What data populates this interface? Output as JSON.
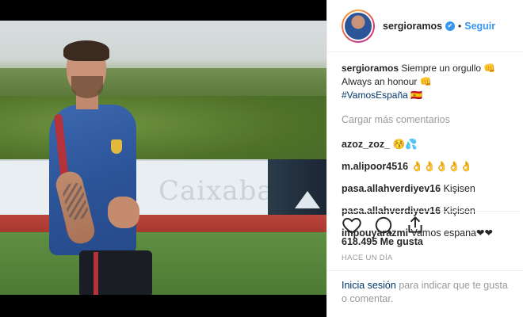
{
  "header": {
    "username": "sergioramos",
    "verified_glyph": "✔",
    "separator": "•",
    "follow_label": "Seguir"
  },
  "caption": {
    "username": "sergioramos",
    "line1": "Siempre un orgullo 👊",
    "line2": "Always an honour 👊",
    "hashtag": "#VamosEspaña 🇪🇸"
  },
  "load_more_label": "Cargar más comentarios",
  "comments": [
    {
      "user": "azoz_zoz_",
      "text": "😚💦"
    },
    {
      "user": "m.alipoor4516",
      "text": "👌👌👌👌👌"
    },
    {
      "user": "pasa.allahverdiyev16",
      "text": "Kişisen"
    },
    {
      "user": "pasa.allahverdiyev16",
      "text": "Kişisen"
    },
    {
      "user": "impouyarazmi",
      "text": "Vamos espana❤❤"
    }
  ],
  "actions": {
    "like_icon": "heart-icon",
    "comment_icon": "comment-icon",
    "share_icon": "share-icon"
  },
  "likes": "618.495 Me gusta",
  "timestamp": "HACE UN DÍA",
  "footer": {
    "login_label": "Inicia sesión",
    "rest_text": " para indicar que te gusta o comentar."
  },
  "photo": {
    "board_text": "Caixabank"
  },
  "colors": {
    "accent": "#3897f0",
    "link": "#003569",
    "muted": "#999999"
  }
}
